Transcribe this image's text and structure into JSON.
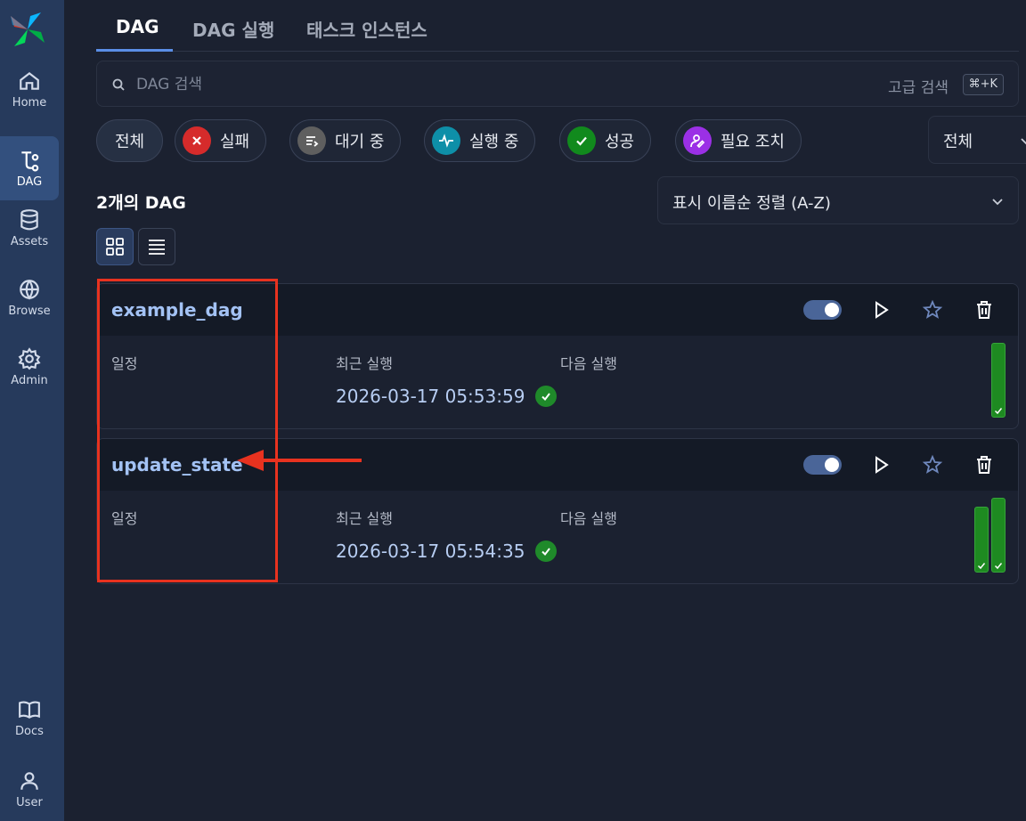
{
  "sidebar": {
    "items": [
      {
        "label": "Home",
        "icon": "home-icon"
      },
      {
        "label": "DAG",
        "icon": "dag-icon",
        "active": true
      },
      {
        "label": "Assets",
        "icon": "database-icon"
      },
      {
        "label": "Browse",
        "icon": "globe-icon"
      },
      {
        "label": "Admin",
        "icon": "gear-icon"
      },
      {
        "label": "Docs",
        "icon": "book-icon"
      },
      {
        "label": "User",
        "icon": "user-icon"
      }
    ]
  },
  "tabs": [
    {
      "label": "DAG",
      "active": true
    },
    {
      "label": "DAG 실행"
    },
    {
      "label": "태스크 인스턴스"
    }
  ],
  "search": {
    "placeholder": "DAG 검색",
    "advanced_label": "고급 검색",
    "shortcut": "⌘+K"
  },
  "filters": {
    "chips": [
      {
        "label": "전체"
      },
      {
        "label": "실패",
        "color": "#d62b2b"
      },
      {
        "label": "대기 중",
        "color": "#5f5f5f"
      },
      {
        "label": "실행 중",
        "color": "#0e8fa8"
      },
      {
        "label": "성공",
        "color": "#118a1d"
      },
      {
        "label": "필요 조치",
        "color": "#9b30e6"
      }
    ],
    "select_value": "전체"
  },
  "list": {
    "count_label": "2개의 DAG",
    "sort_label": "표시 이름순 정렬 (A-Z)"
  },
  "columns": {
    "schedule": "일정",
    "last_run": "최근 실행",
    "next_run": "다음 실행"
  },
  "dags": [
    {
      "name": "example_dag",
      "last_run": "2026-03-17 05:53:59",
      "enabled": true,
      "runs": [
        {
          "state": "success",
          "duration_rel": 1.0
        }
      ]
    },
    {
      "name": "update_state",
      "last_run": "2026-03-17 05:54:35",
      "enabled": true,
      "runs": [
        {
          "state": "success",
          "duration_rel": 0.88
        },
        {
          "state": "success",
          "duration_rel": 1.0
        }
      ]
    }
  ],
  "colors": {
    "accent": "#5a8ee6",
    "success": "#1e8a21",
    "annotation": "#e8321f"
  }
}
